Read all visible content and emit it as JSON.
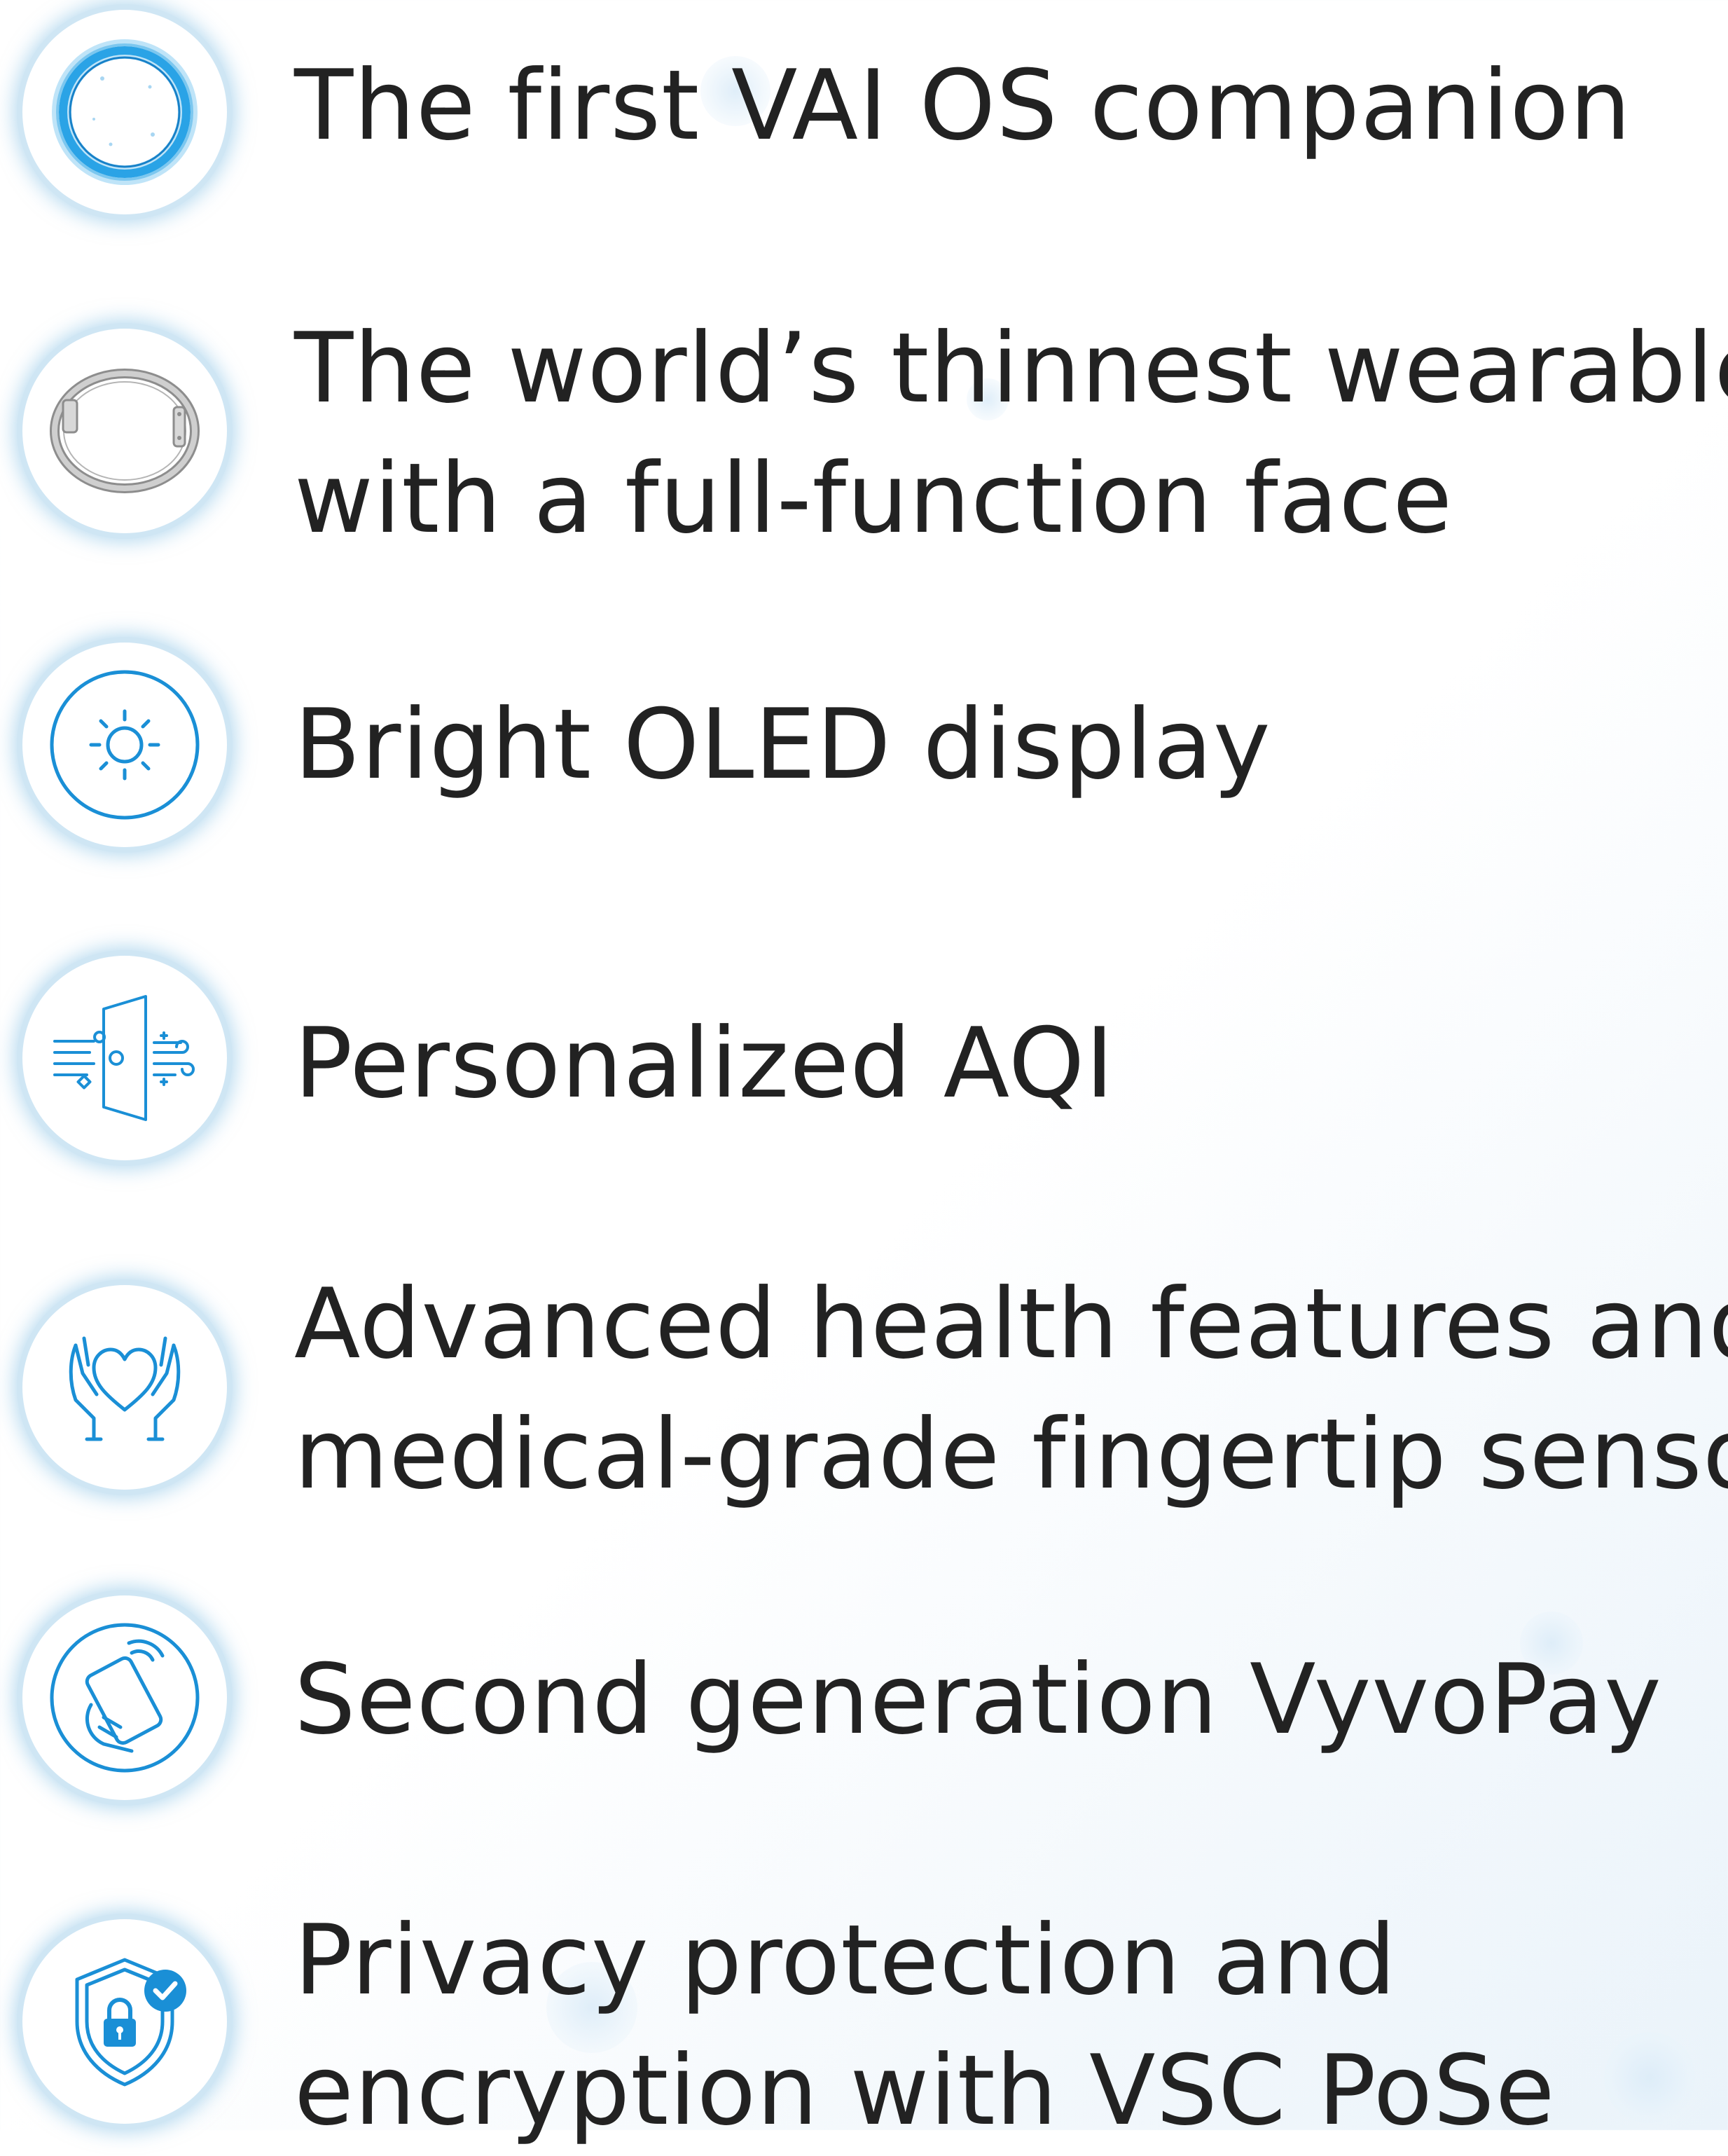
{
  "colors": {
    "accent": "#1a8fd6",
    "text": "#222222",
    "halo": "#9fd0ee"
  },
  "features": [
    {
      "icon": "glowing-ring-icon",
      "lines": [
        "The first VAI OS companion"
      ]
    },
    {
      "icon": "watch-band-icon",
      "lines": [
        "The world’s thinnest wearable",
        "with a full-function face"
      ]
    },
    {
      "icon": "sun-brightness-icon",
      "lines": [
        "Bright OLED display"
      ]
    },
    {
      "icon": "air-quality-door-icon",
      "lines": [
        "Personalized AQI"
      ]
    },
    {
      "icon": "heart-in-hands-icon",
      "lines": [
        "Advanced health features and",
        "medical-grade fingertip sensor"
      ]
    },
    {
      "icon": "contactless-card-payment-icon",
      "lines": [
        "Second generation VyvoPay"
      ]
    },
    {
      "icon": "shield-lock-check-icon",
      "lines": [
        "Privacy protection and",
        "encryption with VSC PoSe"
      ]
    }
  ]
}
